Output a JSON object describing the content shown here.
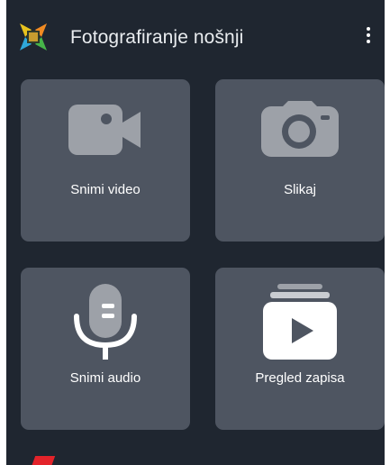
{
  "app": {
    "title": "Fotografiranje nošnji",
    "logo_icon": "star-puzzle-logo-icon",
    "menu_icon": "more-vert-icon"
  },
  "tiles": [
    {
      "id": "video",
      "label": "Snimi video",
      "icon": "videocam-icon"
    },
    {
      "id": "photo",
      "label": "Slikaj",
      "icon": "camera-icon"
    },
    {
      "id": "audio",
      "label": "Snimi audio",
      "icon": "microphone-icon"
    },
    {
      "id": "records",
      "label": "Pregled zapisa",
      "icon": "media-library-icon"
    }
  ],
  "colors": {
    "background": "#1f2630",
    "tile": "#4e5561",
    "icon": "#9da1a8",
    "text": "#ffffff",
    "accent_red": "#e3232a"
  }
}
